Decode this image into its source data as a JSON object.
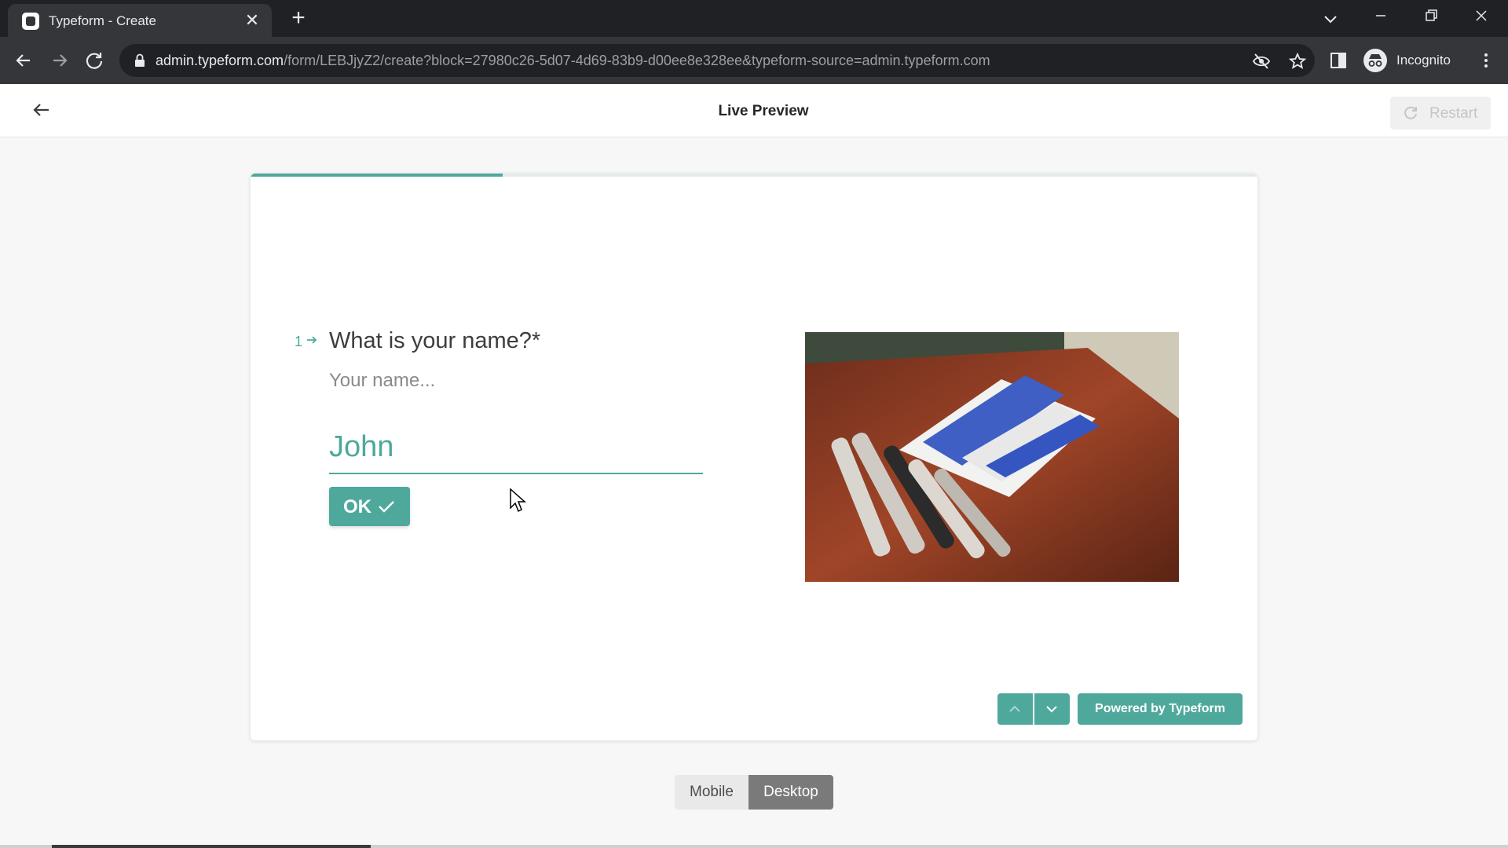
{
  "browser": {
    "tab_title": "Typeform - Create",
    "tab_close": "✕",
    "new_tab": "+",
    "url_host": "admin.typeform.com",
    "url_path": "/form/LEBJjyZ2/create?block=27980c26-5d07-4d69-83b9-d00ee8e328ee&typeform-source=admin.typeform.com",
    "profile_label": "Incognito"
  },
  "header": {
    "title": "Live Preview",
    "restart_label": "Restart"
  },
  "form": {
    "progress": 0.25,
    "question_number": "1",
    "question_title": "What is your name?*",
    "question_description": "Your name...",
    "answer_value": "John",
    "ok_label": "OK",
    "powered_by": "Powered by Typeform",
    "accent_color": "#4ea99c"
  },
  "device_toggle": {
    "mobile_label": "Mobile",
    "desktop_label": "Desktop",
    "selected": "Desktop"
  },
  "icons": [
    "back-arrow-icon",
    "forward-arrow-icon",
    "reload-icon",
    "lock-icon",
    "eye-off-icon",
    "star-icon",
    "side-panel-icon",
    "incognito-icon",
    "kebab-menu-icon",
    "restart-icon",
    "arrow-right-icon",
    "check-icon",
    "chevron-up-icon",
    "chevron-down-icon",
    "mouse-cursor-icon"
  ]
}
